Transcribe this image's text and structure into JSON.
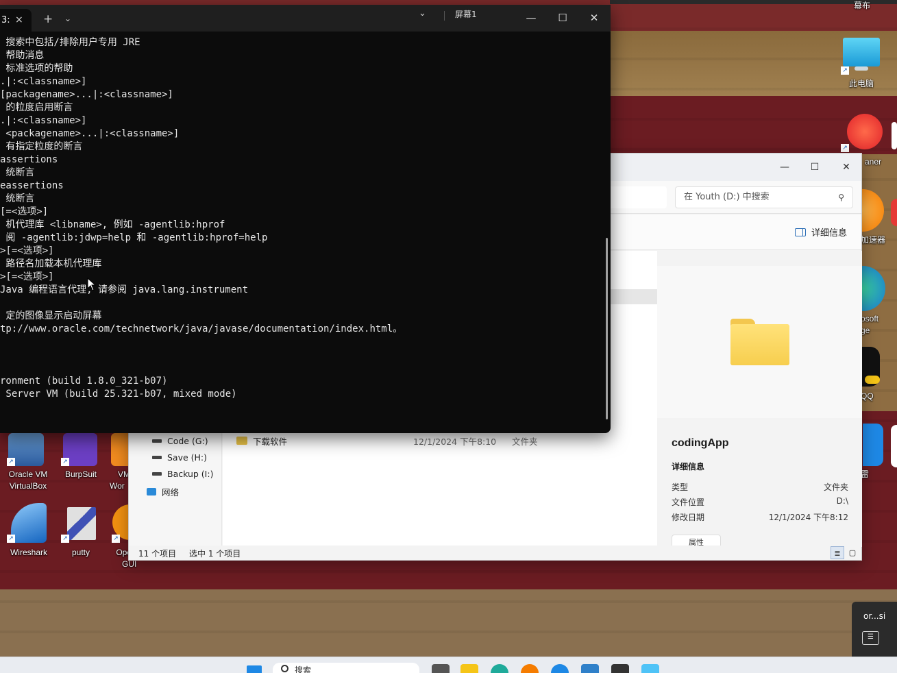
{
  "terminal": {
    "tab_label": "3:",
    "tab_close_icon": "×",
    "new_tab_icon": "+",
    "dropdown_icon": "⌄",
    "chevron_icon": "⌄",
    "screen_label": "屏幕1",
    "minimize_icon": "—",
    "maximize_icon": "☐",
    "close_icon": "✕",
    "lines": [
      " 搜索中包括/排除用户专用 JRE",
      " 帮助消息",
      " 标准选项的帮助",
      ".|:<classname>]",
      "[packagename>...|:<classname>]",
      " 的粒度启用断言",
      ".|:<classname>]",
      " <packagename>...|:<classname>]",
      " 有指定粒度的断言",
      "assertions",
      " 统断言",
      "eassertions",
      " 统断言",
      "[=<选项>]",
      " 机代理库 <libname>, 例如 -agentlib:hprof",
      " 阅 -agentlib:jdwp=help 和 -agentlib:hprof=help",
      ">[=<选项>]",
      " 路径名加载本机代理库",
      ">[=<选项>]",
      "Java 编程语言代理, 请参阅 java.lang.instrument",
      "",
      " 定的图像显示启动屏幕",
      "tp://www.oracle.com/technetwork/java/javase/documentation/index.html。",
      "",
      "",
      "",
      "ronment (build 1.8.0_321-b07)",
      " Server VM (build 25.321-b07, mixed mode)"
    ]
  },
  "explorer": {
    "minimize_icon": "—",
    "maximize_icon": "☐",
    "close_icon": "✕",
    "search_placeholder": "在 Youth (D:) 中搜索",
    "search_icon": "⚲",
    "details_label": "详细信息",
    "nav_items": [
      {
        "label": "Code (G:)"
      },
      {
        "label": "Save (H:)"
      },
      {
        "label": "Backup (I:)"
      },
      {
        "label": "网络"
      }
    ],
    "row": {
      "name": "下载软件",
      "date": "12/1/2024 下午8:10",
      "type": "文件夹"
    },
    "preview": {
      "title": "codingApp",
      "subtitle": "详细信息",
      "props": [
        {
          "key": "类型",
          "value": "文件夹"
        },
        {
          "key": "文件位置",
          "value": "D:\\"
        },
        {
          "key": "修改日期",
          "value": "12/1/2024 下午8:12"
        }
      ],
      "properties_button": "属性"
    },
    "status_count": "11 个项目",
    "status_selected": "选中 1 个项目"
  },
  "desktop": {
    "top_right_label": "幕布",
    "this_pc": "此电脑",
    "ccleaner": "aner",
    "accelerator": "加速器",
    "edge_line1": "osoft",
    "edge_line2": "ge",
    "qq": "QQ",
    "lark": "雷",
    "virtualbox_line1": "Oracle VM",
    "virtualbox_line2": "VirtualBox",
    "burp": "BurpSuit",
    "vmware_line1": "VM",
    "vmware_line2": "Wor",
    "wireshark": "Wireshark",
    "putty": "putty",
    "openvpn_line1": "Ope",
    "openvpn_line2": "GUI",
    "notif_user": "or...si",
    "chat_icon": "☰"
  },
  "taskbar": {
    "search_text": "搜索"
  },
  "colors": {
    "terminal_bg": "#0c0c0c",
    "terminal_text": "#e6e6e6",
    "explorer_bg": "#f3f3f3",
    "folder_yellow": "#f7ce4e"
  }
}
